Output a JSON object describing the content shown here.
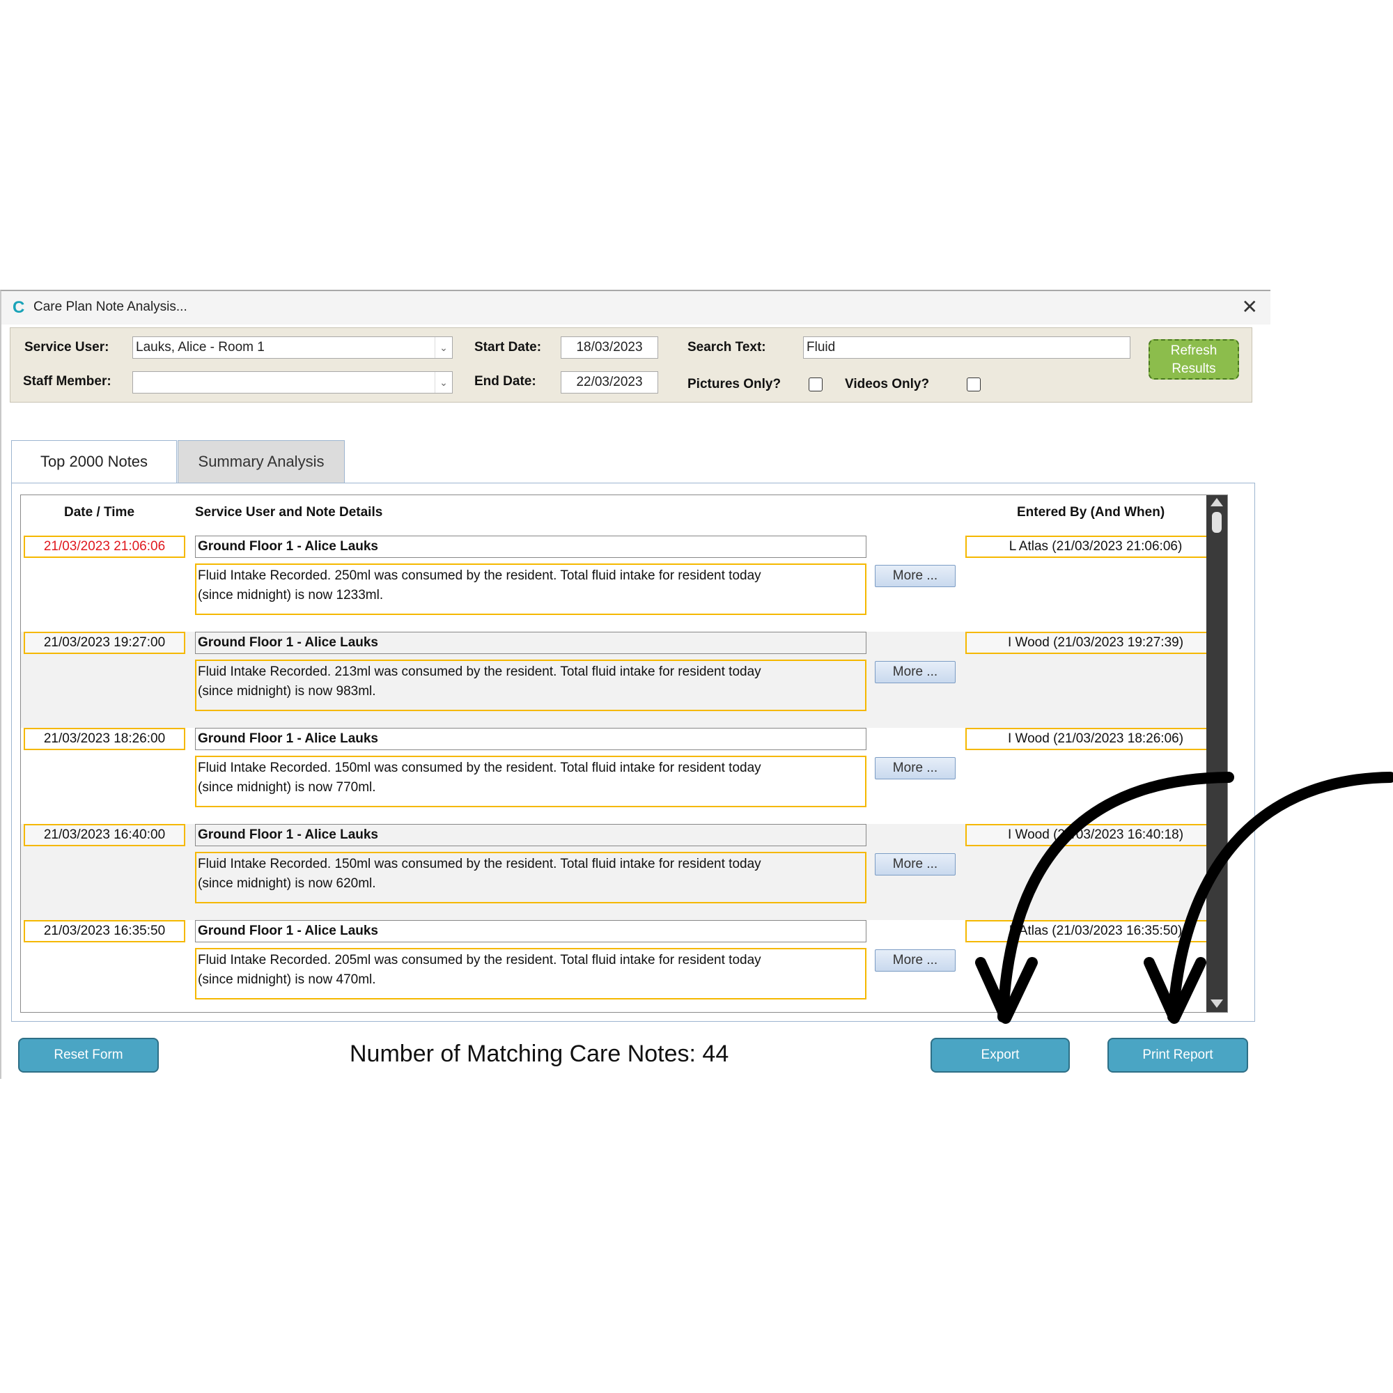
{
  "window": {
    "title": "Care Plan Note Analysis...",
    "close_glyph": "✕",
    "logo_glyph": "C"
  },
  "filters": {
    "service_user_label": "Service User:",
    "service_user_value": "Lauks, Alice - Room 1",
    "staff_member_label": "Staff Member:",
    "staff_member_value": "",
    "start_date_label": "Start Date:",
    "start_date_value": "18/03/2023",
    "end_date_label": "End Date:",
    "end_date_value": "22/03/2023",
    "search_text_label": "Search Text:",
    "search_text_value": "Fluid",
    "pictures_only_label": "Pictures Only?",
    "videos_only_label": "Videos Only?",
    "refresh_line1": "Refresh",
    "refresh_line2": "Results"
  },
  "tabs": [
    {
      "label": "Top 2000 Notes",
      "active": true
    },
    {
      "label": "Summary Analysis",
      "active": false
    }
  ],
  "grid": {
    "headers": {
      "datetime": "Date / Time",
      "details": "Service User and Note Details",
      "entered_by": "Entered By (And When)"
    },
    "more_label": "More ...",
    "rows": [
      {
        "datetime": "21/03/2023 21:06:06",
        "highlight": true,
        "unit": "Ground Floor 1 - Alice Lauks",
        "note_line1": "Fluid Intake Recorded. 250ml was consumed by the resident. Total fluid intake for resident today",
        "note_line2": "(since midnight) is now 1233ml.",
        "entered_by": "L Atlas (21/03/2023 21:06:06)"
      },
      {
        "datetime": "21/03/2023 19:27:00",
        "highlight": false,
        "unit": "Ground Floor 1 - Alice Lauks",
        "note_line1": "Fluid Intake Recorded. 213ml was consumed by the resident. Total fluid intake for resident today",
        "note_line2": "(since midnight) is now 983ml.",
        "entered_by": "I Wood (21/03/2023 19:27:39)"
      },
      {
        "datetime": "21/03/2023 18:26:00",
        "highlight": false,
        "unit": "Ground Floor 1 - Alice Lauks",
        "note_line1": "Fluid Intake Recorded. 150ml was consumed by the resident. Total fluid intake for resident today",
        "note_line2": "(since midnight) is now 770ml.",
        "entered_by": "I Wood (21/03/2023 18:26:06)"
      },
      {
        "datetime": "21/03/2023 16:40:00",
        "highlight": false,
        "unit": "Ground Floor 1 - Alice Lauks",
        "note_line1": "Fluid Intake Recorded. 150ml was consumed by the resident. Total fluid intake for resident today",
        "note_line2": "(since midnight) is now 620ml.",
        "entered_by": "I Wood (21/03/2023 16:40:18)"
      },
      {
        "datetime": "21/03/2023 16:35:50",
        "highlight": false,
        "unit": "Ground Floor 1 - Alice Lauks",
        "note_line1": "Fluid Intake Recorded. 205ml was consumed by the resident. Total fluid intake for resident today",
        "note_line2": "(since midnight) is now 470ml.",
        "entered_by": "L Atlas (21/03/2023 16:35:50)"
      }
    ]
  },
  "footer": {
    "reset_label": "Reset Form",
    "count_text": "Number of Matching Care Notes: 44",
    "export_label": "Export",
    "print_label": "Print Report"
  },
  "colors": {
    "highlight_border": "#f5b800",
    "refresh_button": "#8cbd4c",
    "action_button": "#4aa5c4",
    "red_datetime": "#e0181e"
  }
}
